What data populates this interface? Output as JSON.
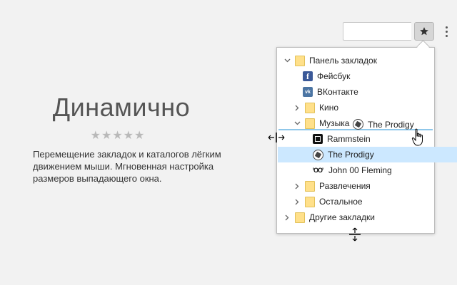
{
  "hero": {
    "title": "Динамично",
    "rating": "★★★★★",
    "description": "Перемещение закладок и каталогов лёгким движением мыши. Мгновенная настройка размеров выпадающего окна."
  },
  "toolbar": {
    "omnibox_value": "",
    "star_icon": "star-icon",
    "menu_icon": "kebab-menu-icon"
  },
  "bookmarks": {
    "bar": "Панель закладок",
    "facebook": "Фейсбук",
    "vk": "ВКонтакте",
    "kino": "Кино",
    "music": "Музыка",
    "rammstein": "Rammstein",
    "prodigy": "The Prodigy",
    "bond": "John 00 Fleming",
    "bond_icon_text": "'OO'",
    "fun": "Развлечения",
    "other": "Остальное",
    "other_bookmarks": "Другие закладки",
    "fb_icon_text": "f",
    "vk_icon_text": "vk"
  },
  "drag": {
    "label": "The Prodigy"
  },
  "colors": {
    "folder": "#ffe08a",
    "selection": "#cce8ff",
    "drop_indicator": "#8fc7ea"
  }
}
